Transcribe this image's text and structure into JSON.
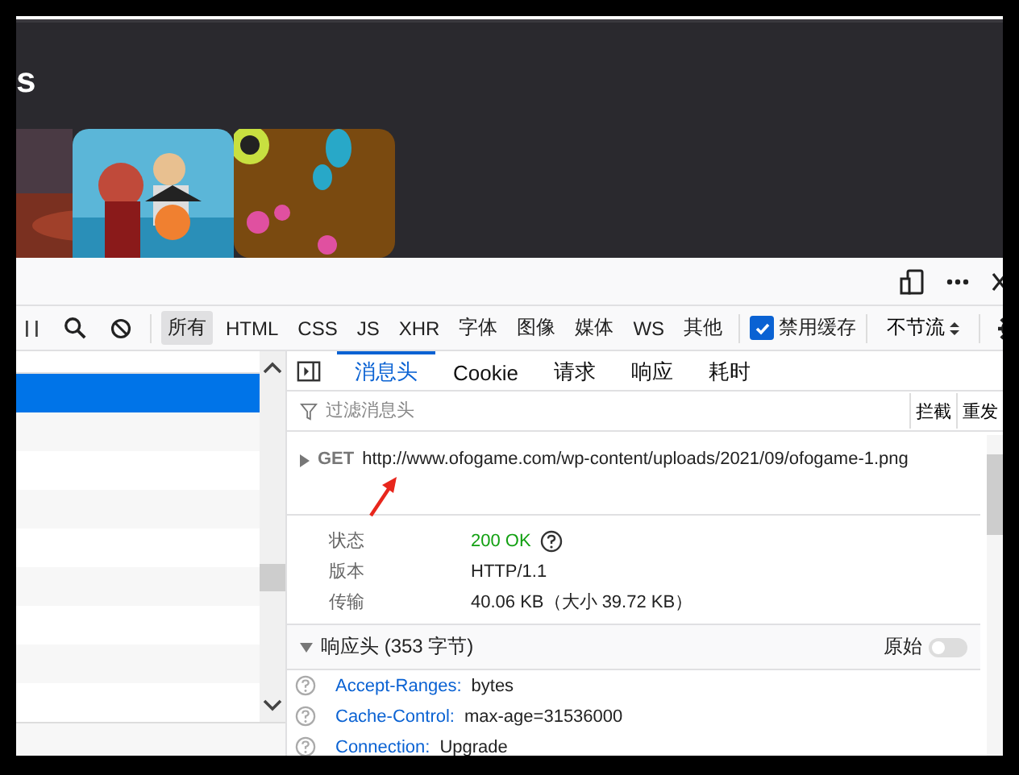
{
  "page": {
    "heading": "s"
  },
  "filter_types": [
    {
      "label": "所有",
      "selected": true
    },
    {
      "label": "HTML",
      "selected": false
    },
    {
      "label": "CSS",
      "selected": false
    },
    {
      "label": "JS",
      "selected": false
    },
    {
      "label": "XHR",
      "selected": false
    },
    {
      "label": "字体",
      "selected": false
    },
    {
      "label": "图像",
      "selected": false
    },
    {
      "label": "媒体",
      "selected": false
    },
    {
      "label": "WS",
      "selected": false
    },
    {
      "label": "其他",
      "selected": false
    }
  ],
  "disable_cache": {
    "label": "禁用缓存",
    "checked": true
  },
  "throttle": "不节流",
  "request_list": [
    {
      "selected": true
    },
    {
      "selected": false
    },
    {
      "selected": false
    },
    {
      "selected": false
    },
    {
      "selected": false
    },
    {
      "selected": false
    },
    {
      "selected": false
    },
    {
      "selected": false
    },
    {
      "selected": false
    }
  ],
  "tabs": [
    {
      "label": "消息头",
      "selected": true
    },
    {
      "label": "Cookie",
      "selected": false
    },
    {
      "label": "请求",
      "selected": false
    },
    {
      "label": "响应",
      "selected": false
    },
    {
      "label": "耗时",
      "selected": false
    }
  ],
  "header_filter": {
    "placeholder": "过滤消息头",
    "buttons": [
      "拦截",
      "重发"
    ]
  },
  "request": {
    "method": "GET",
    "url": "http://www.ofogame.com/wp-content/uploads/2021/09/ofogame-1.png"
  },
  "summary": [
    {
      "label": "状态",
      "value": "200 OK",
      "kind": "status"
    },
    {
      "label": "版本",
      "value": "HTTP/1.1",
      "kind": "text"
    },
    {
      "label": "传输",
      "value": "40.06 KB（大小 39.72 KB）",
      "kind": "text"
    }
  ],
  "response_headers": {
    "title": "响应头 (353 字节)",
    "raw_label": "原始",
    "raw_on": false,
    "items": [
      {
        "name": "Accept-Ranges:",
        "value": "bytes"
      },
      {
        "name": "Cache-Control:",
        "value": "max-age=31536000"
      },
      {
        "name": "Connection:",
        "value": "Upgrade"
      }
    ]
  }
}
